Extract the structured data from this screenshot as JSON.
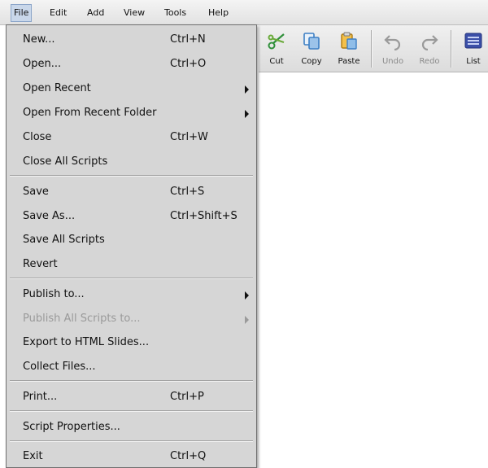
{
  "menubar": {
    "items": [
      {
        "label": "File"
      },
      {
        "label": "Edit"
      },
      {
        "label": "Add"
      },
      {
        "label": "View"
      },
      {
        "label": "Tools"
      },
      {
        "label": "Help"
      }
    ]
  },
  "toolbar": {
    "cut": "Cut",
    "copy": "Copy",
    "paste": "Paste",
    "undo": "Undo",
    "redo": "Redo",
    "list": "List"
  },
  "file_menu": {
    "items": [
      {
        "label": "New...",
        "shortcut": "Ctrl+N"
      },
      {
        "label": "Open...",
        "shortcut": "Ctrl+O"
      },
      {
        "label": "Open Recent",
        "submenu": true
      },
      {
        "label": "Open From Recent Folder",
        "submenu": true
      },
      {
        "label": "Close",
        "shortcut": "Ctrl+W"
      },
      {
        "label": "Close All Scripts"
      },
      {
        "label": "Save",
        "shortcut": "Ctrl+S"
      },
      {
        "label": "Save As...",
        "shortcut": "Ctrl+Shift+S"
      },
      {
        "label": "Save All Scripts"
      },
      {
        "label": "Revert"
      },
      {
        "label": "Publish to...",
        "submenu": true
      },
      {
        "label": "Publish All Scripts to...",
        "submenu": true,
        "disabled": true
      },
      {
        "label": "Export to HTML Slides..."
      },
      {
        "label": "Collect Files..."
      },
      {
        "label": "Print...",
        "shortcut": "Ctrl+P"
      },
      {
        "label": "Script Properties..."
      },
      {
        "label": "Exit",
        "shortcut": "Ctrl+Q"
      }
    ]
  }
}
